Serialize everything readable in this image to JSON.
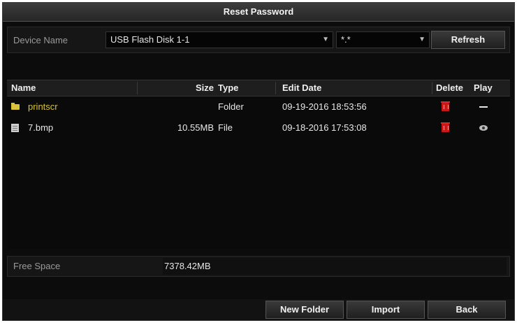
{
  "window": {
    "title": "Reset Password"
  },
  "device": {
    "label": "Device Name",
    "selected_device": "USB Flash Disk 1-1",
    "filter_value": "*.*",
    "refresh_label": "Refresh"
  },
  "table": {
    "columns": [
      "Name",
      "Size",
      "Type",
      "Edit Date",
      "Delete",
      "Play"
    ],
    "rows": [
      {
        "name": "printscr",
        "size": "",
        "type": "Folder",
        "date": "09-19-2016 18:53:56",
        "icon": "folder-icon",
        "play": "none"
      },
      {
        "name": "7.bmp",
        "size": "10.55MB",
        "type": "File",
        "date": "09-18-2016 17:53:08",
        "icon": "file-icon",
        "play": "play"
      }
    ]
  },
  "free_space": {
    "label": "Free Space",
    "value": "7378.42MB"
  },
  "buttons": {
    "new_folder": "New Folder",
    "import": "Import",
    "back": "Back"
  },
  "colors": {
    "background": "#0c0c0c",
    "folder_text": "#d8c33a",
    "delete_icon": "#c81818"
  }
}
